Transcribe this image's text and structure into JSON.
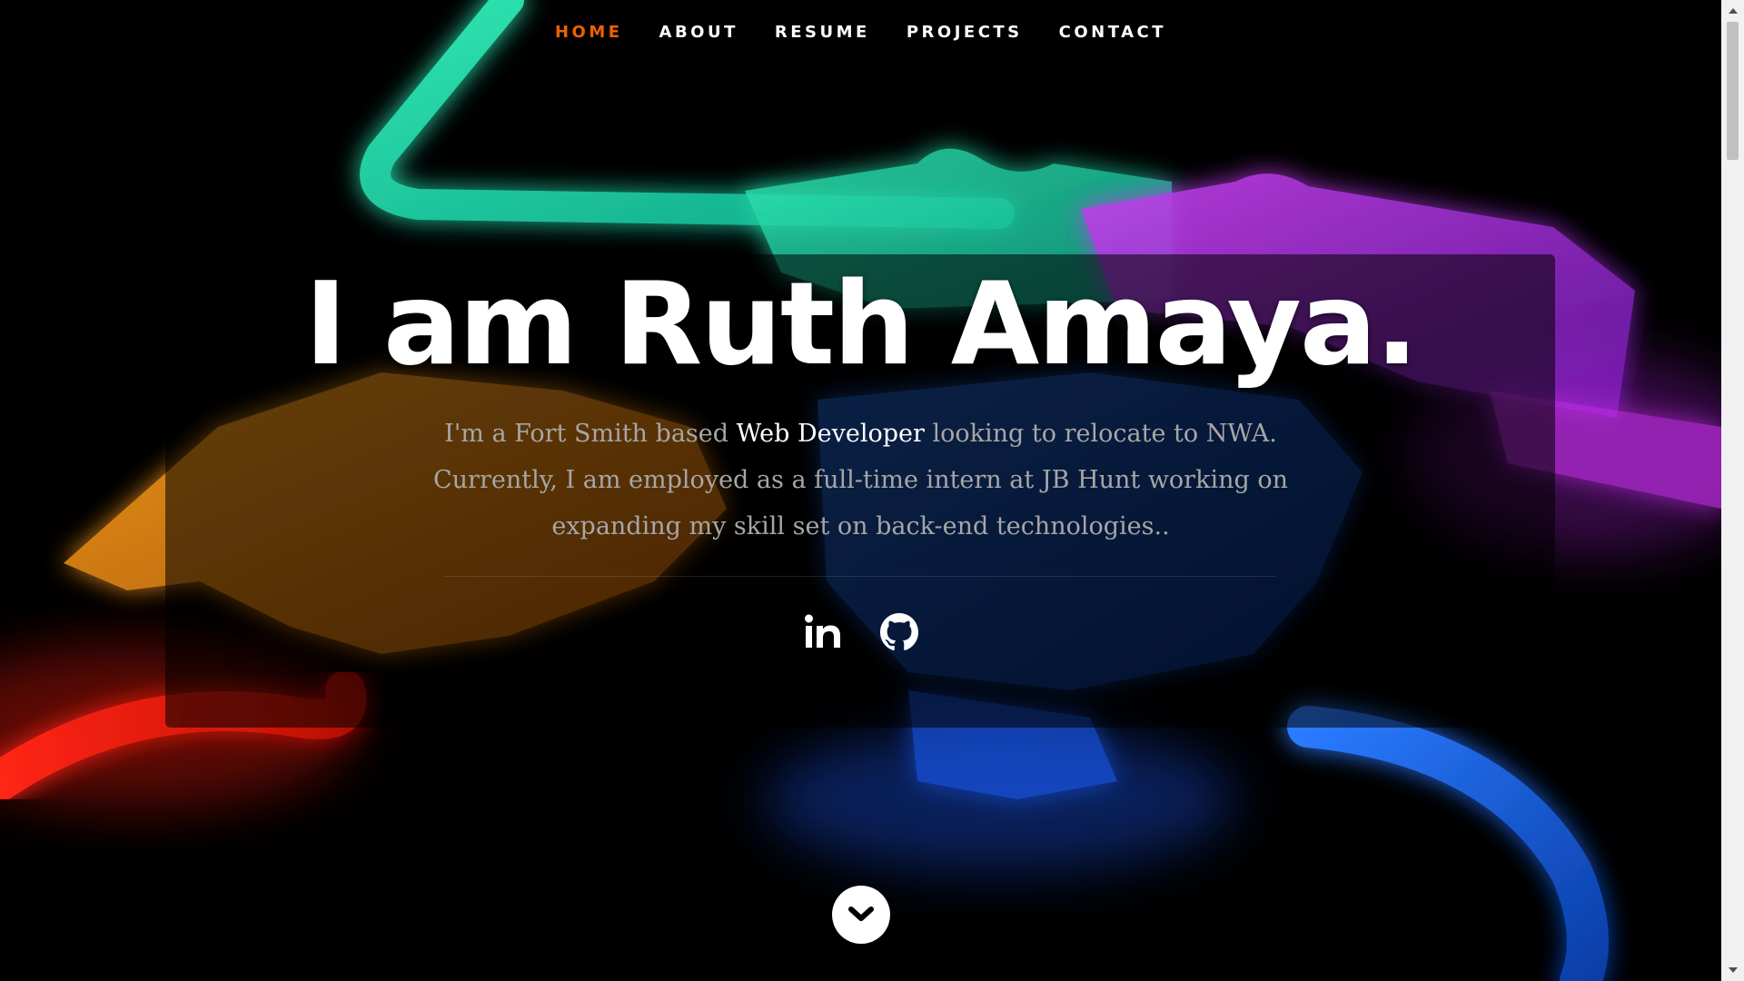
{
  "nav": {
    "items": [
      {
        "label": "HOME",
        "current": true
      },
      {
        "label": "ABOUT",
        "current": false
      },
      {
        "label": "RESUME",
        "current": false
      },
      {
        "label": "PROJECTS",
        "current": false
      },
      {
        "label": "CONTACT",
        "current": false
      }
    ]
  },
  "banner": {
    "headline": "I am Ruth Amaya.",
    "intro_before": "I'm a Fort Smith based ",
    "intro_highlight": "Web Developer",
    "intro_after": " looking to relocate to NWA. Currently, I am employed as a full-time intern at JB Hunt working on expanding my skill set on back-end technologies..",
    "social": [
      {
        "name": "linkedin-icon"
      },
      {
        "name": "github-icon"
      }
    ]
  },
  "scroll_down": {
    "icon": "chevron-down-icon"
  },
  "colors": {
    "accent": "#f06000",
    "text": "#ffffff",
    "muted_text": "#a6a6a6"
  }
}
